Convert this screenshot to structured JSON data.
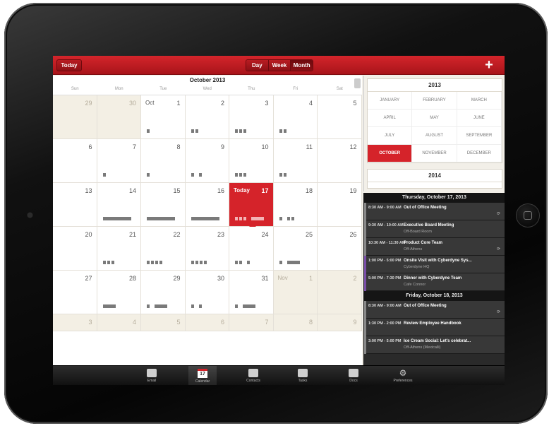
{
  "toolbar": {
    "today_label": "Today",
    "views": [
      "Day",
      "Week",
      "Month"
    ],
    "add_label": "+"
  },
  "calendar": {
    "month_title": "October 2013",
    "weekdays": [
      "Sun",
      "Mon",
      "Tue",
      "Wed",
      "Thu",
      "Fri",
      "Sat"
    ],
    "weeks": [
      [
        {
          "n": "29",
          "o": true
        },
        {
          "n": "30",
          "o": true
        },
        {
          "n": "1",
          "m": "Oct",
          "b": "s"
        },
        {
          "n": "2",
          "b": "ss"
        },
        {
          "n": "3",
          "b": "sss"
        },
        {
          "n": "4",
          "b": "ss"
        },
        {
          "n": "5"
        }
      ],
      [
        {
          "n": "6"
        },
        {
          "n": "7",
          "b": "s"
        },
        {
          "n": "8",
          "b": "s"
        },
        {
          "n": "9",
          "b": "s s"
        },
        {
          "n": "10",
          "b": "sss"
        },
        {
          "n": "11",
          "b": "ss"
        },
        {
          "n": "12"
        }
      ],
      [
        {
          "n": "13"
        },
        {
          "n": "14",
          "b": "w"
        },
        {
          "n": "15",
          "b": "w"
        },
        {
          "n": "16",
          "b": "w"
        },
        {
          "n": "17",
          "today": "Today",
          "b": "sss m"
        },
        {
          "n": "18",
          "b": "s ss"
        },
        {
          "n": "19"
        }
      ],
      [
        {
          "n": "20"
        },
        {
          "n": "21",
          "b": "sss"
        },
        {
          "n": "22",
          "b": "ssss"
        },
        {
          "n": "23",
          "b": "ssss"
        },
        {
          "n": "24",
          "b": "ss s"
        },
        {
          "n": "25",
          "b": "s m"
        },
        {
          "n": "26"
        }
      ],
      [
        {
          "n": "27"
        },
        {
          "n": "28",
          "b": "m"
        },
        {
          "n": "29",
          "b": "s m"
        },
        {
          "n": "30",
          "b": "s s"
        },
        {
          "n": "31",
          "b": "s m"
        },
        {
          "n": "1",
          "m": "Nov",
          "o": true
        },
        {
          "n": "2",
          "o": true
        }
      ],
      [
        {
          "n": "3",
          "o": true
        },
        {
          "n": "4",
          "o": true
        },
        {
          "n": "5",
          "o": true
        },
        {
          "n": "6",
          "o": true
        },
        {
          "n": "7",
          "o": true
        },
        {
          "n": "8",
          "o": true
        },
        {
          "n": "9",
          "o": true
        }
      ]
    ]
  },
  "year_picker": {
    "year": "2013",
    "months": [
      "JANUARY",
      "FEBRUARY",
      "MARCH",
      "APRIL",
      "MAY",
      "JUNE",
      "JULY",
      "AUGUST",
      "SEPTEMBER",
      "OCTOBER",
      "NOVEMBER",
      "DECEMBER"
    ],
    "selected": "OCTOBER",
    "next_year": "2014"
  },
  "agenda": [
    {
      "header": "Thursday, October 17, 2013"
    },
    {
      "time": "8:30 AM - 9:00 AM",
      "title": "Out of Office Meeting",
      "loc": "",
      "icon": "⟳"
    },
    {
      "time": "9:30 AM - 10:00 AM",
      "title": "Executive Board Meeting",
      "loc": "Off-Board Room",
      "icon": ""
    },
    {
      "time": "10:30 AM - 11:30 AM",
      "title": "Product Core Team",
      "loc": "Off-Athens",
      "icon": "⟳"
    },
    {
      "time": "1:00 PM - 5:00 PM",
      "title": "Onsite Visit with Cyberdyne Sys...",
      "loc": "Cyberdyne HQ",
      "icon": "",
      "purple": true
    },
    {
      "time": "5:00 PM - 7:30 PM",
      "title": "Dinner with Cyberdyne Team",
      "loc": "Cafe Connor",
      "icon": "",
      "purple": true
    },
    {
      "header": "Friday, October 18, 2013"
    },
    {
      "time": "8:30 AM - 9:00 AM",
      "title": "Out of Office Meeting",
      "loc": "",
      "icon": "⟳"
    },
    {
      "time": "1:30 PM - 2:00 PM",
      "title": "Review Employee Handbook",
      "loc": "",
      "icon": ""
    },
    {
      "time": "3:00 PM - 5:00 PM",
      "title": "Ice Cream Social: Let's celebrat...",
      "loc": "Off-Athens (Mexicalli)",
      "icon": ""
    }
  ],
  "tabs": [
    {
      "label": "Email",
      "icon": "envelope-icon"
    },
    {
      "label": "Calendar",
      "icon": "calendar-icon",
      "num": "17",
      "active": true
    },
    {
      "label": "Contacts",
      "icon": "contacts-icon"
    },
    {
      "label": "Tasks",
      "icon": "tasks-icon"
    },
    {
      "label": "Docs",
      "icon": "docs-icon"
    },
    {
      "label": "Preferences",
      "icon": "gear-icon"
    }
  ]
}
